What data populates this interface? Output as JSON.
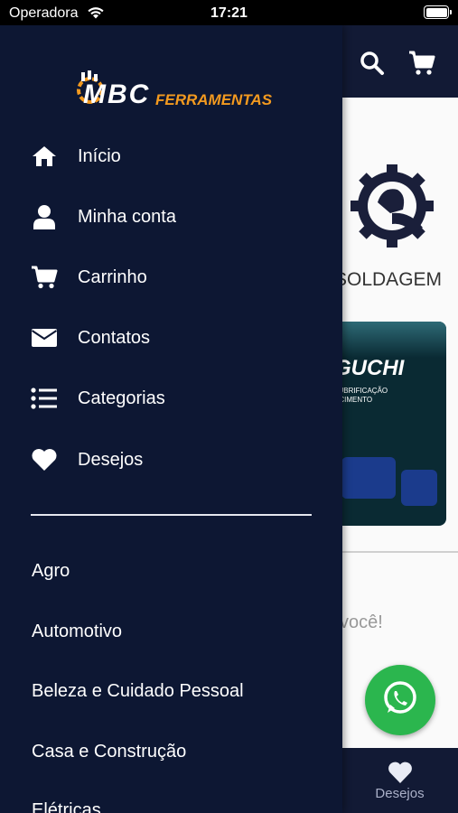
{
  "status_bar": {
    "carrier": "Operadora",
    "time": "17:21"
  },
  "brand": {
    "logo_primary": "MBC",
    "logo_secondary": "FERRAMENTAS",
    "accent_color": "#f39a1f",
    "drawer_color": "#0d1733"
  },
  "menu": [
    {
      "label": "Início",
      "icon": "home-icon"
    },
    {
      "label": "Minha conta",
      "icon": "user-icon"
    },
    {
      "label": "Carrinho",
      "icon": "cart-icon"
    },
    {
      "label": "Contatos",
      "icon": "envelope-icon"
    },
    {
      "label": "Categorias",
      "icon": "list-icon"
    },
    {
      "label": "Desejos",
      "icon": "heart-icon"
    }
  ],
  "categories": [
    "Agro",
    "Automotivo",
    "Beleza e Cuidado Pessoal",
    "Casa e Construção",
    "Elétricas"
  ],
  "background": {
    "category_label": "SOLDAGEM",
    "banner_brand": "GUCHI",
    "banner_subtitle_1": "LUBRIFICAÇÃO",
    "banner_subtitle_2": "ECIMENTO",
    "partial_text": "você!",
    "bottom_tab_label": "Desejos"
  }
}
